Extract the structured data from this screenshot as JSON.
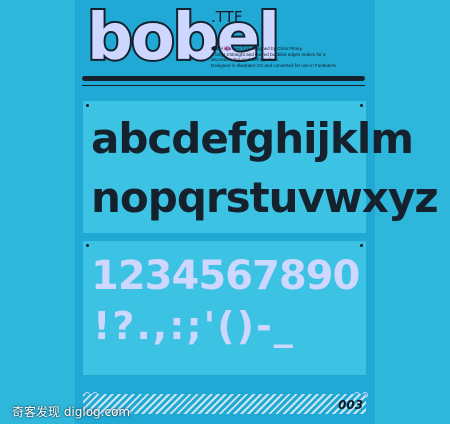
{
  "poster": {
    "logo": "bobel",
    "extension": ".TTF",
    "description_lines": [
      "Bobel is a new font designed by Chris Pitney.",
      "A large s'straight and curved bubbled edges makes for a",
      "decorative but readable typeface.",
      "Designed in Illustrator CS and converted for use in FontlabA5"
    ],
    "lowercase_row_1": "abcdefghijklm",
    "lowercase_row_2": "nopqrstuvwxyz",
    "digits": "1234567890",
    "punctuation": "!?.,:;'()-_",
    "issue_number": "003"
  },
  "watermark": "奇客发现 diglog.com",
  "colors": {
    "background": "#2fb6db",
    "panel": "#3cc2e3",
    "ink": "#15222e",
    "light_glyph": "#cdd7ff",
    "dot_accent": "#c06bc0"
  }
}
